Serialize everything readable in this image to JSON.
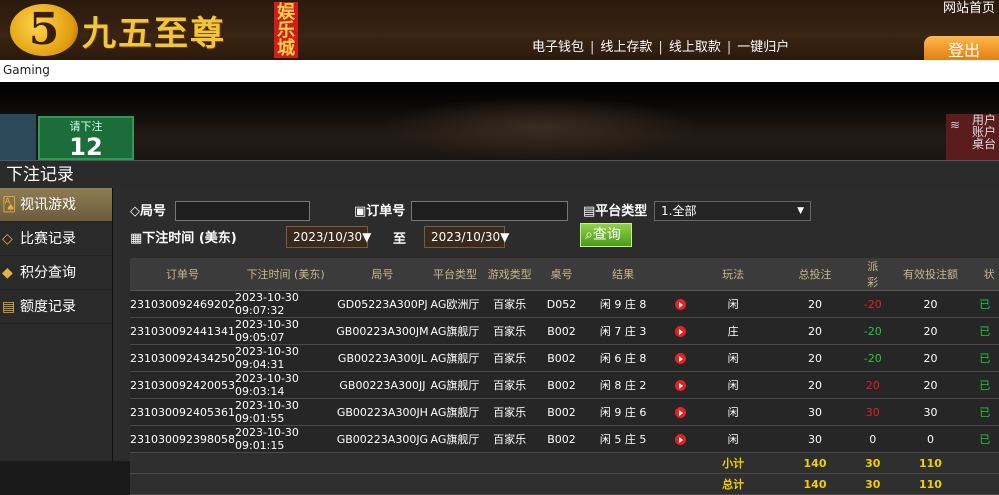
{
  "header": {
    "logo_mark": "5",
    "logo_text": "九五至尊",
    "logo_sub": "娱乐城",
    "nav": [
      "电子钱包",
      "线上存款",
      "线上取款",
      "一键归户"
    ],
    "home_link": "网站首页",
    "logout_label": "登出"
  },
  "gaming_label": "Gaming",
  "banner": {
    "bet_prompt": "请下注",
    "bet_count": "12",
    "right_lines": [
      "用户",
      "账户",
      "桌台"
    ]
  },
  "section_title": "下注记录",
  "sidebar": {
    "items": [
      {
        "label": "视讯游戏",
        "icon": "cards-icon"
      },
      {
        "label": "比赛记录",
        "icon": "diamond-tag-icon"
      },
      {
        "label": "积分查询",
        "icon": "gem-icon"
      },
      {
        "label": "额度记录",
        "icon": "document-icon"
      }
    ]
  },
  "filters": {
    "round_label": "局号",
    "order_label": "订单号",
    "platform_label": "平台类型",
    "platform_value": "1.全部",
    "time_label": "下注时间 (美东)",
    "date_from": "2023/10/30",
    "to_label": "至",
    "date_to": "2023/10/30",
    "query_label": "查询"
  },
  "table": {
    "headers": [
      "订单号",
      "下注时间 (美东)",
      "局号",
      "平台类型",
      "游戏类型",
      "桌号",
      "结果",
      "",
      "玩法",
      "总投注",
      "派彩",
      "有效投注额",
      "状"
    ],
    "rows": [
      {
        "order": "231030092469202",
        "time": "2023-10-30 09:07:32",
        "round": "GD05223A300PJ",
        "platform": "AG欧洲厅",
        "game": "百家乐",
        "table": "D052",
        "result": "闲 9 庄 8",
        "play": "闲",
        "bet": "20",
        "payout": "-20",
        "valid": "20",
        "status": "已"
      },
      {
        "order": "231030092441341",
        "time": "2023-10-30 09:05:07",
        "round": "GB00223A300JM",
        "platform": "AG旗舰厅",
        "game": "百家乐",
        "table": "B002",
        "result": "闲 7 庄 3",
        "play": "庄",
        "bet": "20",
        "payout": "-20",
        "valid": "20",
        "status": "已"
      },
      {
        "order": "231030092434250",
        "time": "2023-10-30 09:04:31",
        "round": "GB00223A300JL",
        "platform": "AG旗舰厅",
        "game": "百家乐",
        "table": "B002",
        "result": "闲 6 庄 8",
        "play": "闲",
        "bet": "20",
        "payout": "-20",
        "valid": "20",
        "status": "已"
      },
      {
        "order": "231030092420053",
        "time": "2023-10-30 09:03:14",
        "round": "GB00223A300JJ",
        "platform": "AG旗舰厅",
        "game": "百家乐",
        "table": "B002",
        "result": "闲 8 庄 2",
        "play": "闲",
        "bet": "20",
        "payout": "20",
        "valid": "20",
        "status": "已"
      },
      {
        "order": "231030092405361",
        "time": "2023-10-30 09:01:55",
        "round": "GB00223A300JH",
        "platform": "AG旗舰厅",
        "game": "百家乐",
        "table": "B002",
        "result": "闲 9 庄 6",
        "play": "闲",
        "bet": "30",
        "payout": "30",
        "valid": "30",
        "status": "已"
      },
      {
        "order": "231030092398058",
        "time": "2023-10-30 09:01:15",
        "round": "GB00223A300JG",
        "platform": "AG旗舰厅",
        "game": "百家乐",
        "table": "B002",
        "result": "闲 5 庄 5",
        "play": "闲",
        "bet": "30",
        "payout": "0",
        "valid": "0",
        "status": "已"
      }
    ],
    "payout_colors": [
      "neg",
      "pos",
      "pos",
      "neg",
      "neg",
      "plain"
    ],
    "subtotal": {
      "label": "小计",
      "bet": "140",
      "payout": "30",
      "valid": "110"
    },
    "total": {
      "label": "总计",
      "bet": "140",
      "payout": "30",
      "valid": "110"
    }
  },
  "colors": {
    "accent": "#f3c53a",
    "positive": "#22c93a",
    "negative": "#e02020",
    "subtotal": "#f0d000"
  }
}
